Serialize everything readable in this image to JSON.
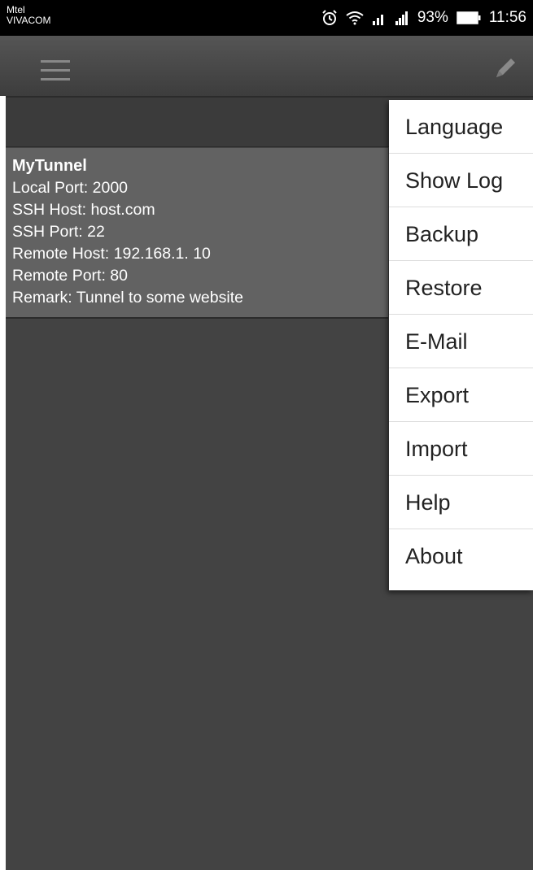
{
  "status_bar": {
    "carrier_1": "Mtel",
    "carrier_2": "VIVACOM",
    "battery_percent": "93%",
    "time": "11:56",
    "icons": [
      "alarm-icon",
      "wifi-icon",
      "signal-icon",
      "signal-icon",
      "battery-icon"
    ]
  },
  "app_bar": {
    "menu_icon": "hamburger-menu-icon",
    "edit_icon": "pencil-edit-icon"
  },
  "tunnel": {
    "name": "MyTunnel",
    "lines": [
      "Local Port: 2000",
      "SSH Host: host.com",
      "SSH Port: 22",
      "Remote Host: 192.168.1. 10",
      "Remote Port: 80",
      "Remark: Tunnel to some website"
    ]
  },
  "overflow_menu": {
    "items": [
      "Language",
      "Show Log",
      "Backup",
      "Restore",
      "E-Mail",
      "Export",
      "Import",
      "Help",
      "About"
    ]
  },
  "colors": {
    "background": "#434343",
    "app_bar": "#4a4a4a",
    "card": "#626262",
    "menu": "#ffffff",
    "menu_text": "#222222"
  }
}
